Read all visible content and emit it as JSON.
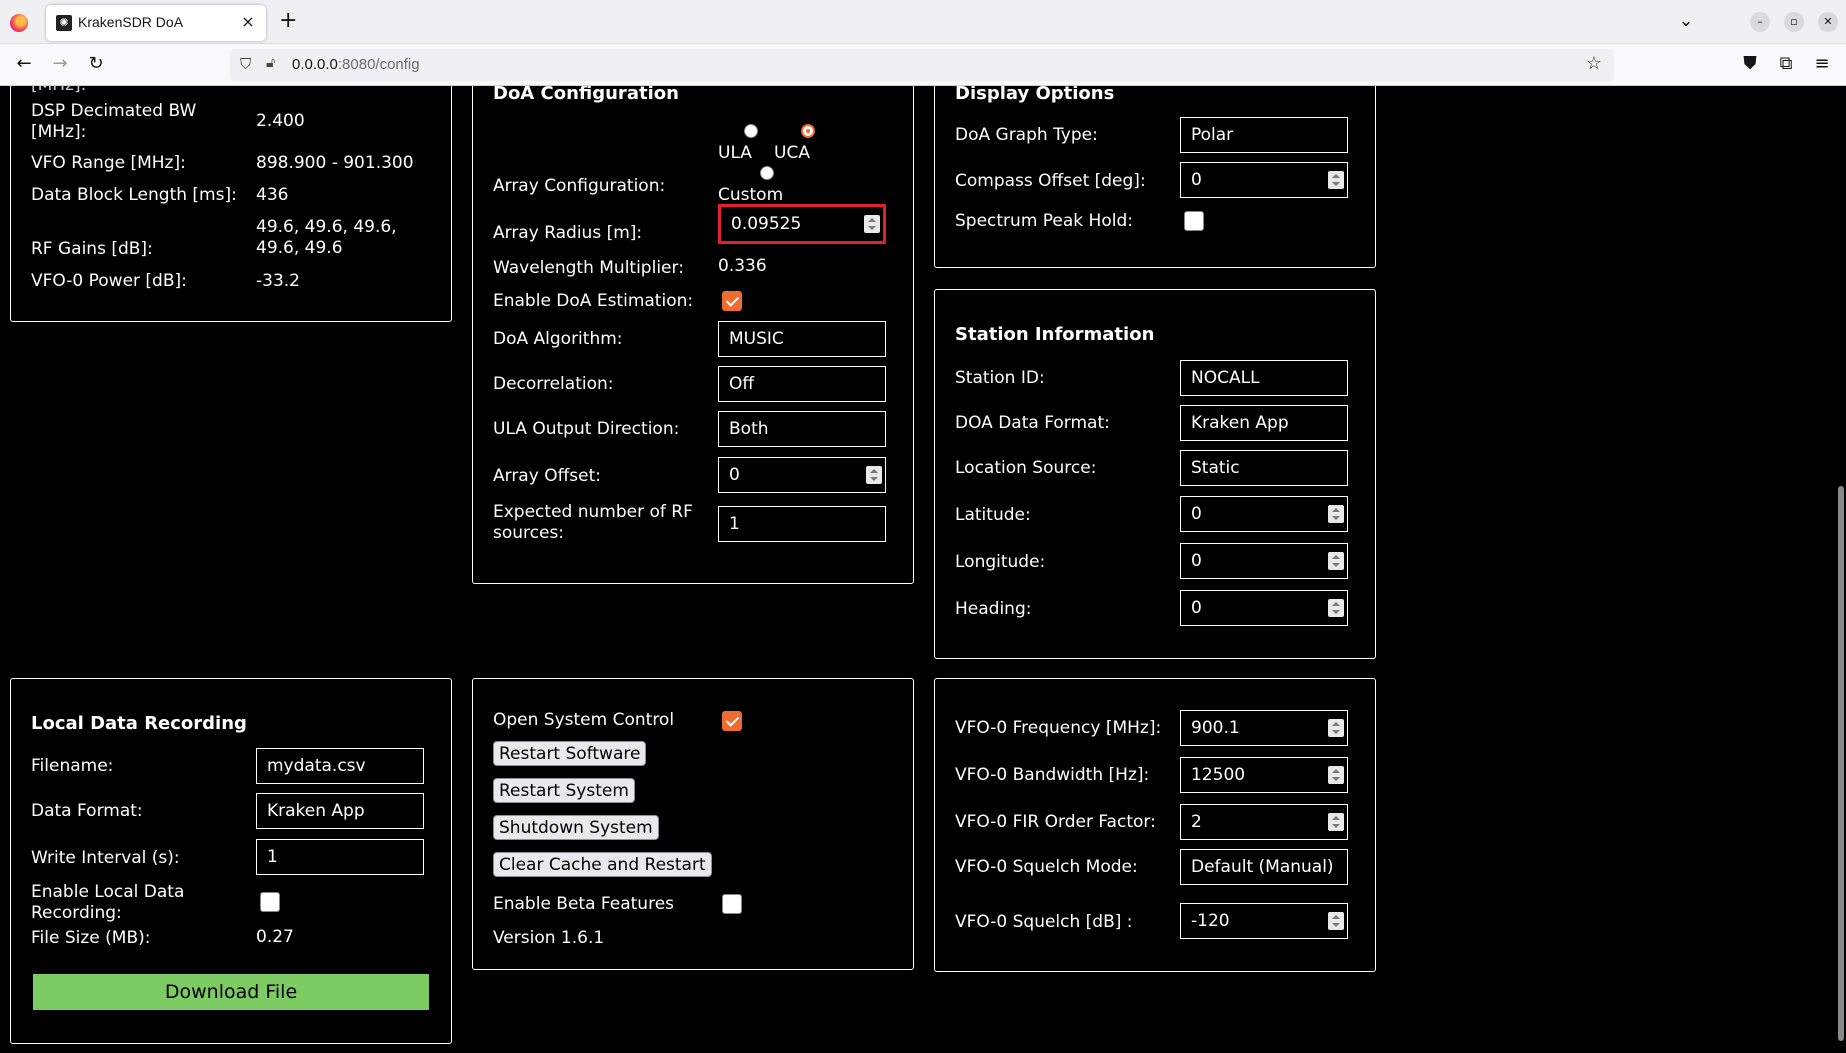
{
  "browser": {
    "tab_title": "KrakenSDR DoA",
    "tab_close": "×",
    "new_tab": "+",
    "url_host": "0.0.0.0",
    "url_rest": ":8080/config"
  },
  "status_panel": {
    "rows": [
      {
        "label": "DSP Decimated BW [MHz]:",
        "value": "2.400"
      },
      {
        "label": "VFO Range [MHz]:",
        "value": "898.900 - 901.300"
      },
      {
        "label": "Data Block Length [ms]:",
        "value": "436"
      },
      {
        "label": "RF Gains [dB]:",
        "value": "49.6, 49.6, 49.6, 49.6, 49.6"
      },
      {
        "label": "VFO-0 Power [dB]:",
        "value": "-33.2"
      }
    ]
  },
  "doa_config": {
    "title": "DoA Configuration",
    "array_configuration_label": "Array Configuration:",
    "array_options": [
      "ULA",
      "UCA",
      "Custom"
    ],
    "array_selected": "UCA",
    "array_radius_label": "Array Radius [m]:",
    "array_radius_value": "0.09525",
    "wavelength_multiplier_label": "Wavelength Multiplier:",
    "wavelength_multiplier_value": "0.336",
    "enable_doa_label": "Enable DoA Estimation:",
    "enable_doa_checked": true,
    "doa_algorithm_label": "DoA Algorithm:",
    "doa_algorithm_value": "MUSIC",
    "decorrelation_label": "Decorrelation:",
    "decorrelation_value": "Off",
    "ula_output_label": "ULA Output Direction:",
    "ula_output_value": "Both",
    "array_offset_label": "Array Offset:",
    "array_offset_value": "0",
    "expected_sources_label": "Expected number of RF sources:",
    "expected_sources_value": "1"
  },
  "display_options": {
    "title": "Display Options",
    "graph_type_label": "DoA Graph Type:",
    "graph_type_value": "Polar",
    "compass_offset_label": "Compass Offset [deg]:",
    "compass_offset_value": "0",
    "peak_hold_label": "Spectrum Peak Hold:",
    "peak_hold_checked": false
  },
  "station_info": {
    "title": "Station Information",
    "station_id_label": "Station ID:",
    "station_id_value": "NOCALL",
    "data_format_label": "DOA Data Format:",
    "data_format_value": "Kraken App",
    "location_source_label": "Location Source:",
    "location_source_value": "Static",
    "latitude_label": "Latitude:",
    "latitude_value": "0",
    "longitude_label": "Longitude:",
    "longitude_value": "0",
    "heading_label": "Heading:",
    "heading_value": "0"
  },
  "recording": {
    "title": "Local Data Recording",
    "filename_label": "Filename:",
    "filename_value": "mydata.csv",
    "data_format_label": "Data Format:",
    "data_format_value": "Kraken App",
    "write_interval_label": "Write Interval (s):",
    "write_interval_value": "1",
    "enable_label": "Enable Local Data Recording:",
    "enable_checked": false,
    "file_size_label": "File Size (MB):",
    "file_size_value": "0.27",
    "download_label": "Download File"
  },
  "system": {
    "open_control_label": "Open System Control",
    "open_control_checked": true,
    "restart_software": "Restart Software",
    "restart_system": "Restart System",
    "shutdown_system": "Shutdown System",
    "clear_cache": "Clear Cache and Restart",
    "beta_label": "Enable Beta Features",
    "beta_checked": false,
    "version": "Version 1.6.1"
  },
  "vfo": {
    "freq_label": "VFO-0 Frequency [MHz]:",
    "freq_value": "900.1",
    "bw_label": "VFO-0 Bandwidth [Hz]:",
    "bw_value": "12500",
    "fir_label": "VFO-0 FIR Order Factor:",
    "fir_value": "2",
    "squelch_mode_label": "VFO-0 Squelch Mode:",
    "squelch_mode_value": "Default (Manual)",
    "squelch_label": "VFO-0 Squelch [dB] :",
    "squelch_value": "-120"
  },
  "colors": {
    "accent": "#ef6b2f",
    "download_button": "#7ccc63",
    "focus_outline": "#e0202a"
  }
}
